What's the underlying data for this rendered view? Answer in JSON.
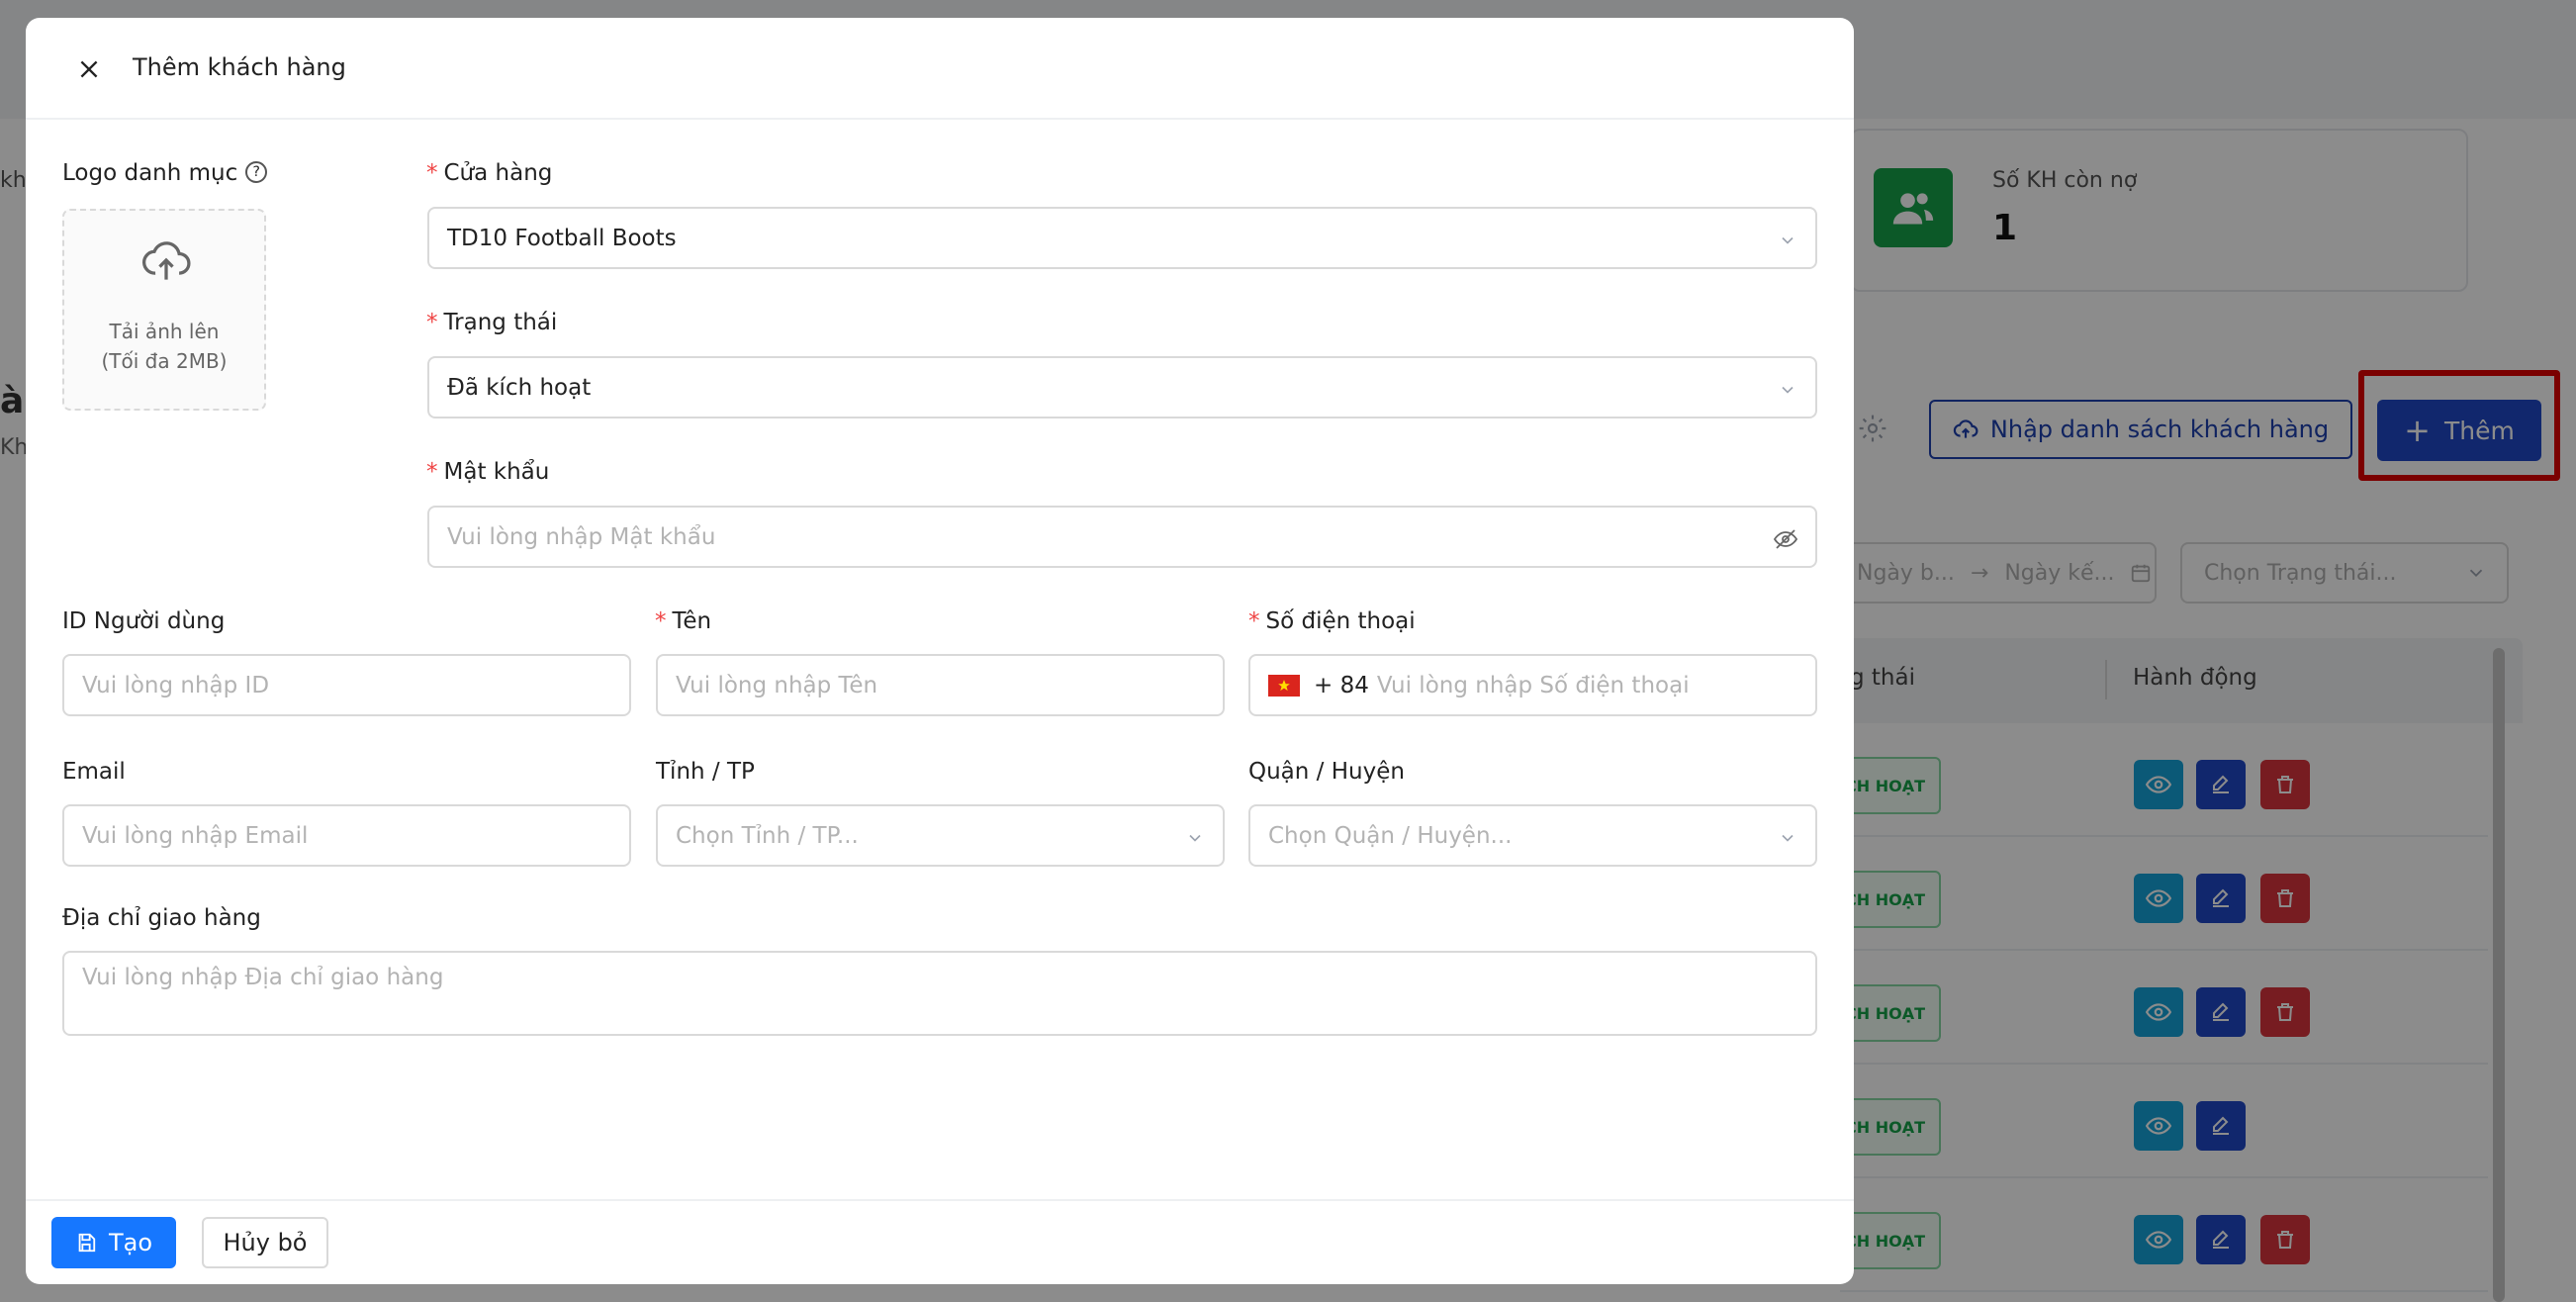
{
  "background": {
    "stat": {
      "label": "Số KH còn nợ",
      "value": "1"
    },
    "import_button": "Nhập danh sách khách hàng",
    "add_button": "Thêm",
    "date_start_placeholder": "Ngày b...",
    "date_end_placeholder": "Ngày kế...",
    "status_filter_placeholder": "Chọn Trạng thái...",
    "table_headers": {
      "status": "g thái",
      "actions": "Hành động"
    },
    "rows": [
      {
        "badge": "CH HOẠT"
      },
      {
        "badge": "CH HOẠT"
      },
      {
        "badge": "CH HOẠT"
      },
      {
        "badge": "CH HOẠT"
      },
      {
        "badge": "CH HOẠT"
      }
    ],
    "left_fragments": {
      "a": "kh",
      "b": "àı",
      "c": "Kh"
    },
    "colors": {
      "primary": "#1f48c6",
      "danger": "#d9343c",
      "info": "#14a2d9",
      "success": "#16a34a",
      "highlight": "#e10000"
    }
  },
  "modal": {
    "title": "Thêm khách hàng",
    "logo": {
      "label": "Logo danh mục",
      "upload_line1": "Tải ảnh lên",
      "upload_line2": "(Tối đa 2MB)"
    },
    "store": {
      "label": "Cửa hàng",
      "value": "TD10 Football Boots"
    },
    "status": {
      "label": "Trạng thái",
      "value": "Đã kích hoạt"
    },
    "password": {
      "label": "Mật khẩu",
      "placeholder": "Vui lòng nhập Mật khẩu"
    },
    "user_id": {
      "label": "ID Người dùng",
      "placeholder": "Vui lòng nhập ID"
    },
    "name": {
      "label": "Tên",
      "placeholder": "Vui lòng nhập Tên"
    },
    "phone": {
      "label": "Số điện thoại",
      "prefix": "+ 84",
      "placeholder": "Vui lòng nhập Số điện thoại"
    },
    "email": {
      "label": "Email",
      "placeholder": "Vui lòng nhập Email"
    },
    "province": {
      "label": "Tỉnh / TP",
      "placeholder": "Chọn Tỉnh / TP..."
    },
    "district": {
      "label": "Quận / Huyện",
      "placeholder": "Chọn Quận / Huyện..."
    },
    "address": {
      "label": "Địa chỉ giao hàng",
      "placeholder": "Vui lòng nhập Địa chỉ giao hàng"
    },
    "create_button": "Tạo",
    "cancel_button": "Hủy bỏ"
  }
}
